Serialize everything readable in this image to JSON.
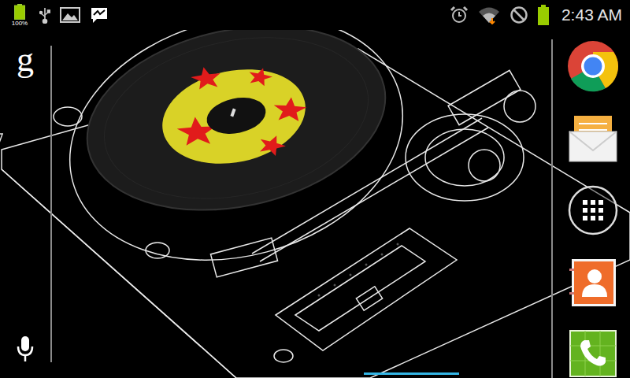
{
  "status_bar": {
    "battery_level": 1,
    "battery_percent": "100%",
    "time": "2:43 AM"
  },
  "search_bar": {
    "logo": "g"
  }
}
